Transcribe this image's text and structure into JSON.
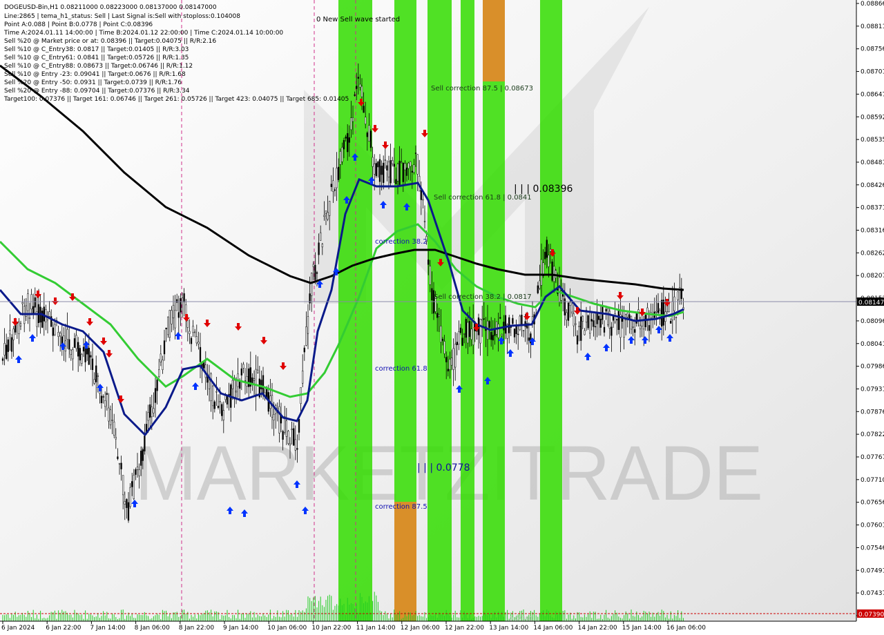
{
  "header": {
    "lines": [
      "DOGEUSD-Bin,H1  0.08211000 0.08223000 0.08137000 0.08147000",
      "Line:2865 | tema_h1_status: Sell | Last Signal is:Sell with stoploss:0.104008",
      "Point A:0.088 | Point B:0.0778 | Point C:0.08396",
      "Time A:2024.01.11 14:00:00 | Time B:2024.01.12 22:00:00 | Time C:2024.01.14 10:00:00",
      "Sell %20 @ Market price or at: 0.08396 || Target:0.04075 || R/R:2.16",
      "Sell %10 @ C_Entry38: 0.0817 || Target:0.01405 || R/R:3.03",
      "Sell %10 @ C_Entry61: 0.0841 || Target:0.05726 || R/R:1.35",
      "Sell %10 @ C_Entry88: 0.08673 || Target:0.06746 || R/R:1.12",
      "Sell %10 @ Entry -23: 0.09041 || Target:0.0676 || R/R:1.68",
      "Sell %20 @ Entry -50: 0.0931 || Target:0.0739 || R/R:1.76",
      "Sell %20 @ Entry -88: 0.09704 || Target:0.07376 || R/R:3.34",
      "Target100: 0.07376 || Target 161: 0.06746 || Target 261: 0.05726 || Target 423: 0.04075 || Target 685: 0.01405"
    ]
  },
  "annotations": {
    "new_wave": "0 New Sell wave started",
    "sell_corr_875": "Sell correction 87.5 | 0.08673",
    "sell_corr_618": "Sell correction 61.8 | 0.0841",
    "sell_corr_382": "Sell correction 38.2 | 0.0817",
    "corr_382": "correction 38.2",
    "corr_618": "correction 61.8",
    "corr_875": "correction 87.5",
    "point_c": "| | | 0.08396",
    "point_b": "| | | 0.0778",
    "bottom_label": "0.07390"
  },
  "watermark": "MARKETZITRADE",
  "colors": {
    "bright_green": "#33dd00",
    "orange": "#e08a2a",
    "ma_black": "#000000",
    "ma_navy": "#0a1a8a",
    "ma_green": "#33cc33",
    "sell_arrow": "#e00000",
    "buy_arrow": "#0033ff",
    "current_price_bg": "#000000",
    "level_bg": "#cc0000"
  },
  "chart_data": {
    "type": "candlestick",
    "symbol": "DOGEUSD-Bin",
    "timeframe": "H1",
    "ohlc": {
      "open": 0.08211,
      "high": 0.08223,
      "low": 0.08137,
      "close": 0.08147
    },
    "current_price": "0.08147",
    "level_price": "0.07390",
    "ylim": [
      0.0734,
      0.0888
    ],
    "y_ticks": [
      "0.08866",
      "0.08811",
      "0.08756",
      "0.08701",
      "0.08647",
      "0.08592",
      "0.08535",
      "0.08481",
      "0.08426",
      "0.08371",
      "0.08316",
      "0.08262",
      "0.08207",
      "0.08152",
      "0.08096",
      "0.08041",
      "0.07986",
      "0.07931",
      "0.07876",
      "0.07822",
      "0.07767",
      "0.07710",
      "0.07656",
      "0.07601",
      "0.07546",
      "0.07491",
      "0.07437",
      "0.07382"
    ],
    "x_ticks": [
      "6 Jan 2024",
      "6 Jan 22:00",
      "7 Jan 14:00",
      "8 Jan 06:00",
      "8 Jan 22:00",
      "9 Jan 14:00",
      "10 Jan 06:00",
      "10 Jan 22:00",
      "11 Jan 14:00",
      "12 Jan 06:00",
      "12 Jan 22:00",
      "13 Jan 14:00",
      "14 Jan 06:00",
      "14 Jan 22:00",
      "15 Jan 14:00",
      "16 Jan 06:00"
    ],
    "points": {
      "A": 0.088,
      "B": 0.0778,
      "C": 0.08396
    }
  }
}
